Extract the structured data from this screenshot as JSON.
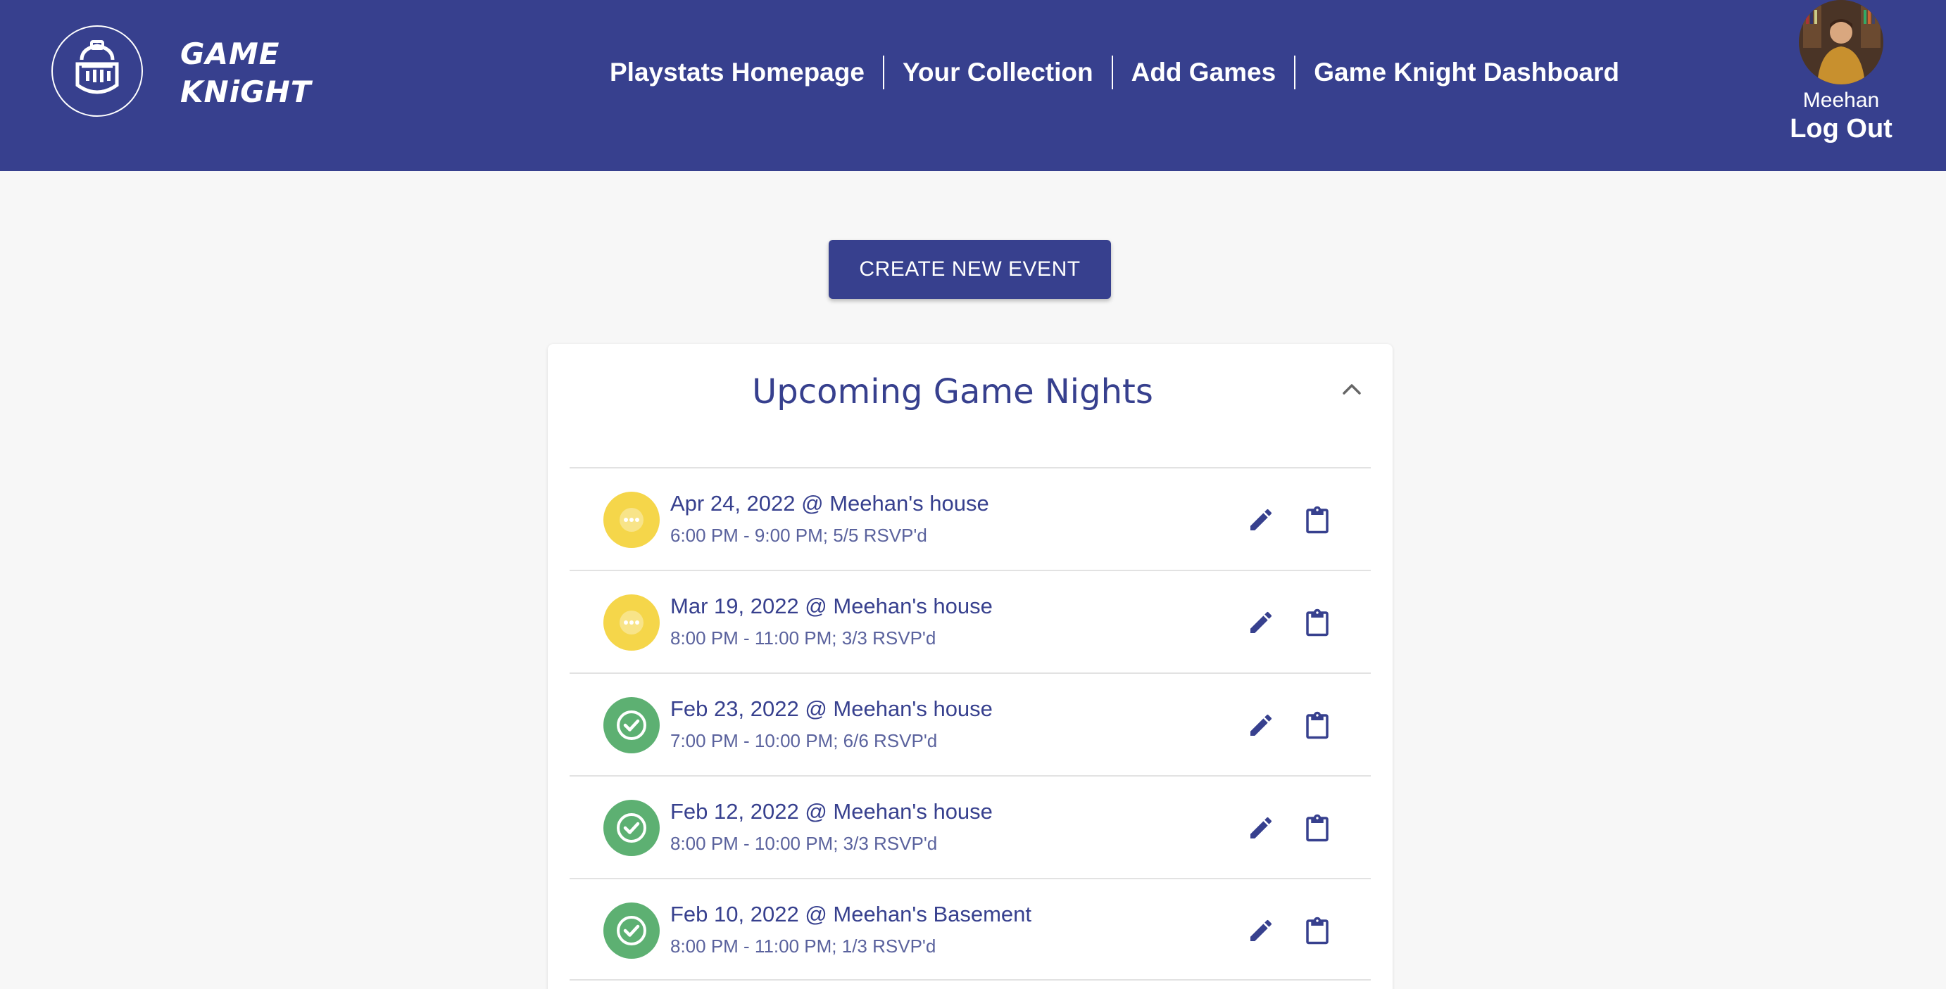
{
  "brand": {
    "line1": "GAME",
    "line2": "KNiGHT",
    "logo_icon": "knight-helmet-icon"
  },
  "nav": [
    {
      "label": "Playstats Homepage"
    },
    {
      "label": "Your Collection"
    },
    {
      "label": "Add Games"
    },
    {
      "label": "Game Knight Dashboard"
    }
  ],
  "user": {
    "name": "Meehan",
    "logout_label": "Log Out"
  },
  "actions": {
    "create_event_label": "CREATE NEW EVENT"
  },
  "upcoming": {
    "title": "Upcoming Game Nights",
    "collapse_icon": "chevron-up-icon",
    "events": [
      {
        "title": "Apr 24, 2022 @ Meehan's house",
        "details": "6:00 PM - 9:00 PM; 5/5 RSVP'd",
        "status": "pending"
      },
      {
        "title": "Mar 19, 2022 @ Meehan's house",
        "details": "8:00 PM - 11:00 PM; 3/3 RSVP'd",
        "status": "pending"
      },
      {
        "title": "Feb 23, 2022 @ Meehan's house",
        "details": "7:00 PM - 10:00 PM; 6/6 RSVP'd",
        "status": "done"
      },
      {
        "title": "Feb 12, 2022 @ Meehan's house",
        "details": "8:00 PM - 10:00 PM; 3/3 RSVP'd",
        "status": "done"
      },
      {
        "title": "Feb 10, 2022 @ Meehan's Basement",
        "details": "8:00 PM - 11:00 PM; 1/3 RSVP'd",
        "status": "done"
      }
    ]
  },
  "colors": {
    "primary": "#37408e",
    "pending": "#f5d64a",
    "done": "#5db072",
    "background": "#f7f7f7"
  }
}
